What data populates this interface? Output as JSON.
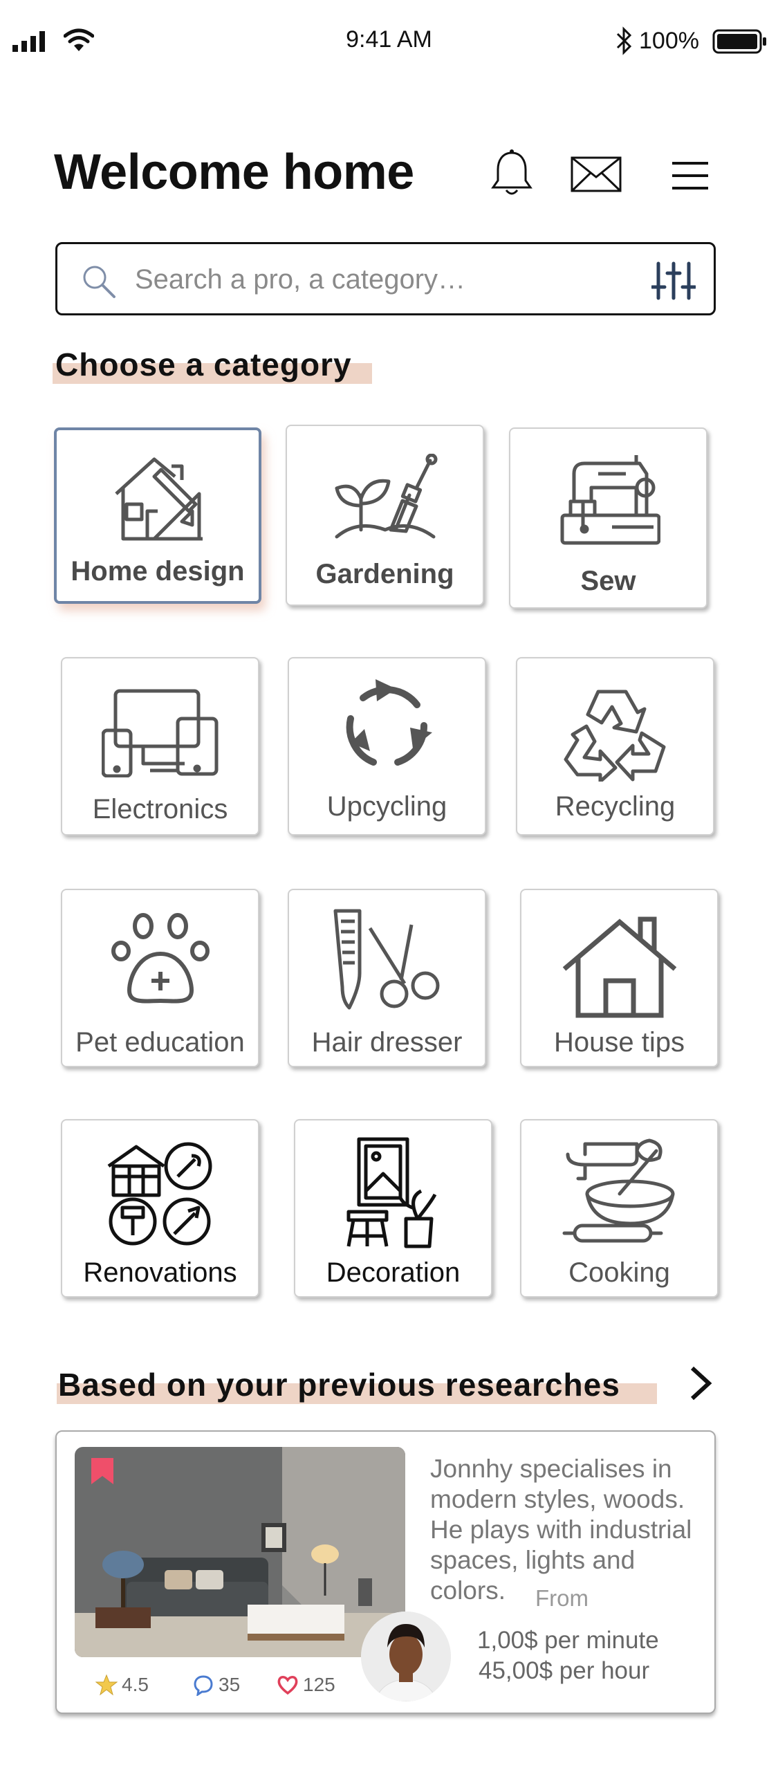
{
  "status_bar": {
    "time": "9:41 AM",
    "battery": "100%"
  },
  "header": {
    "title": "Welcome home",
    "icons": [
      "bell-icon",
      "mail-icon",
      "hamburger-menu-icon"
    ]
  },
  "search": {
    "placeholder": "Search a pro, a category…"
  },
  "categories": {
    "heading": "Choose a category",
    "items": [
      {
        "label": "Home design",
        "icon": "home-design-icon",
        "selected": true
      },
      {
        "label": "Gardening",
        "icon": "gardening-icon"
      },
      {
        "label": "Sew",
        "icon": "sewing-machine-icon"
      },
      {
        "label": "Electronics",
        "icon": "devices-icon"
      },
      {
        "label": "Upcycling",
        "icon": "upcycling-arrows-icon"
      },
      {
        "label": "Recycling",
        "icon": "recycling-icon"
      },
      {
        "label": "Pet education",
        "icon": "paw-icon"
      },
      {
        "label": "Hair dresser",
        "icon": "comb-scissors-icon"
      },
      {
        "label": "House tips",
        "icon": "house-icon"
      },
      {
        "label": "Renovations",
        "icon": "renovation-tools-icon"
      },
      {
        "label": "Decoration",
        "icon": "decoration-icon"
      },
      {
        "label": "Cooking",
        "icon": "cooking-icon"
      }
    ]
  },
  "previous": {
    "heading": "Based on your previous researches",
    "card": {
      "description": "Jonnhy specialises in modern styles, woods. He plays with industrial spaces, lights and colors.",
      "from_label": "From",
      "price_minute": "1,00$ per minute",
      "price_hour": "45,00$ per hour",
      "rating": "4.5",
      "comments": "35",
      "likes": "125"
    }
  },
  "colors": {
    "highlight": "#eed4c6",
    "selected_border": "#6f85a6",
    "icon_gray": "#555555",
    "heart": "#e0405a",
    "star": "#f2c94c",
    "comment": "#4a7bd0"
  }
}
